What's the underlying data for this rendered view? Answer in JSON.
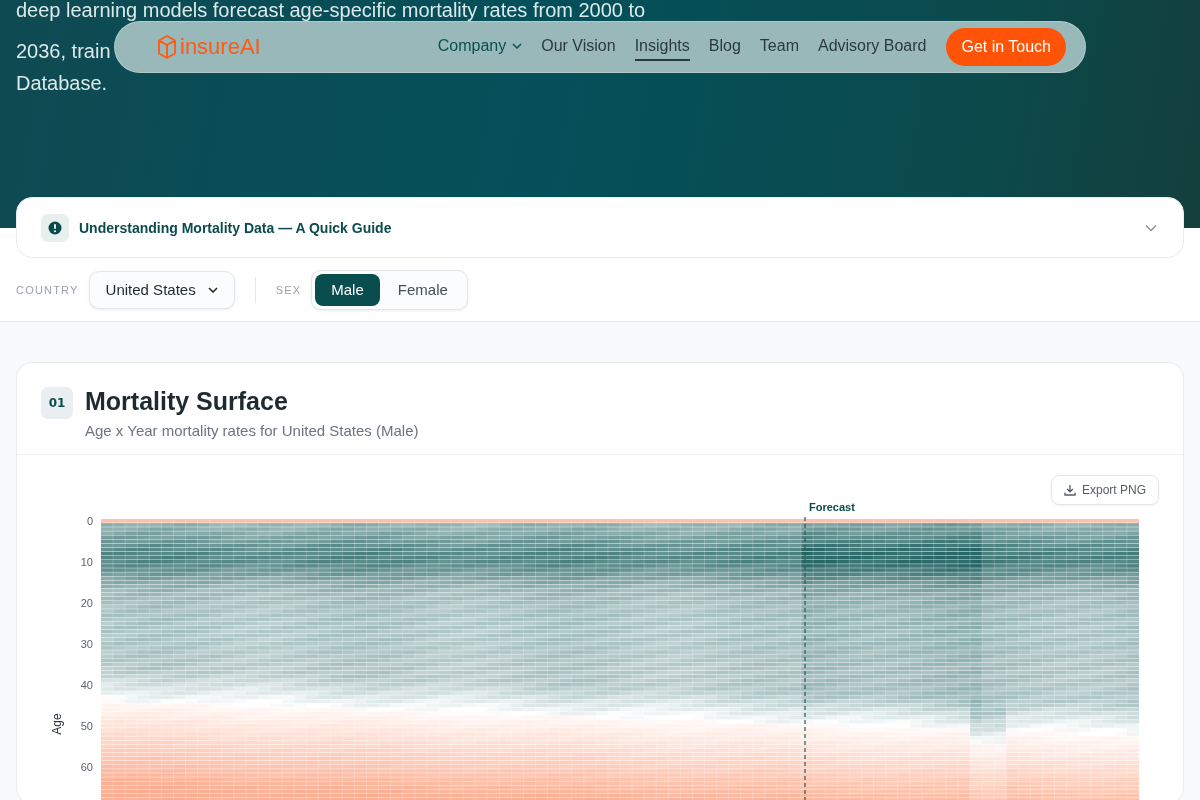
{
  "hero": {
    "lines": [
      "deep learning models forecast age-specific mortality rates from 2000 to",
      "2036, train",
      "Database."
    ]
  },
  "nav": {
    "logo": "insureAI",
    "items": [
      {
        "label": "Company",
        "kind": "dropdown",
        "selected": false
      },
      {
        "label": "Our Vision",
        "kind": "link",
        "selected": false
      },
      {
        "label": "Insights",
        "kind": "link",
        "selected": true
      },
      {
        "label": "Blog",
        "kind": "link",
        "selected": false
      },
      {
        "label": "Team",
        "kind": "link",
        "selected": false
      },
      {
        "label": "Advisory Board",
        "kind": "link",
        "selected": false
      }
    ],
    "cta": "Get in Touch"
  },
  "guide": {
    "title": "Understanding Mortality Data — A Quick Guide",
    "expanded": false
  },
  "filters": {
    "country_label": "COUNTRY",
    "country_value": "United States",
    "sex_label": "SEX",
    "sex_options": [
      {
        "label": "Male",
        "selected": true
      },
      {
        "label": "Female",
        "selected": false
      }
    ]
  },
  "section": {
    "number": "01",
    "title": "Mortality Surface",
    "subtitle": "Age x Year mortality rates for United States (Male)",
    "export_button": "Export PNG",
    "chart": {
      "forecast_label": "Forecast",
      "y_axis_label": "Age",
      "y_ticks": [
        "0",
        "10",
        "20",
        "30",
        "40",
        "50",
        "60"
      ]
    }
  }
}
